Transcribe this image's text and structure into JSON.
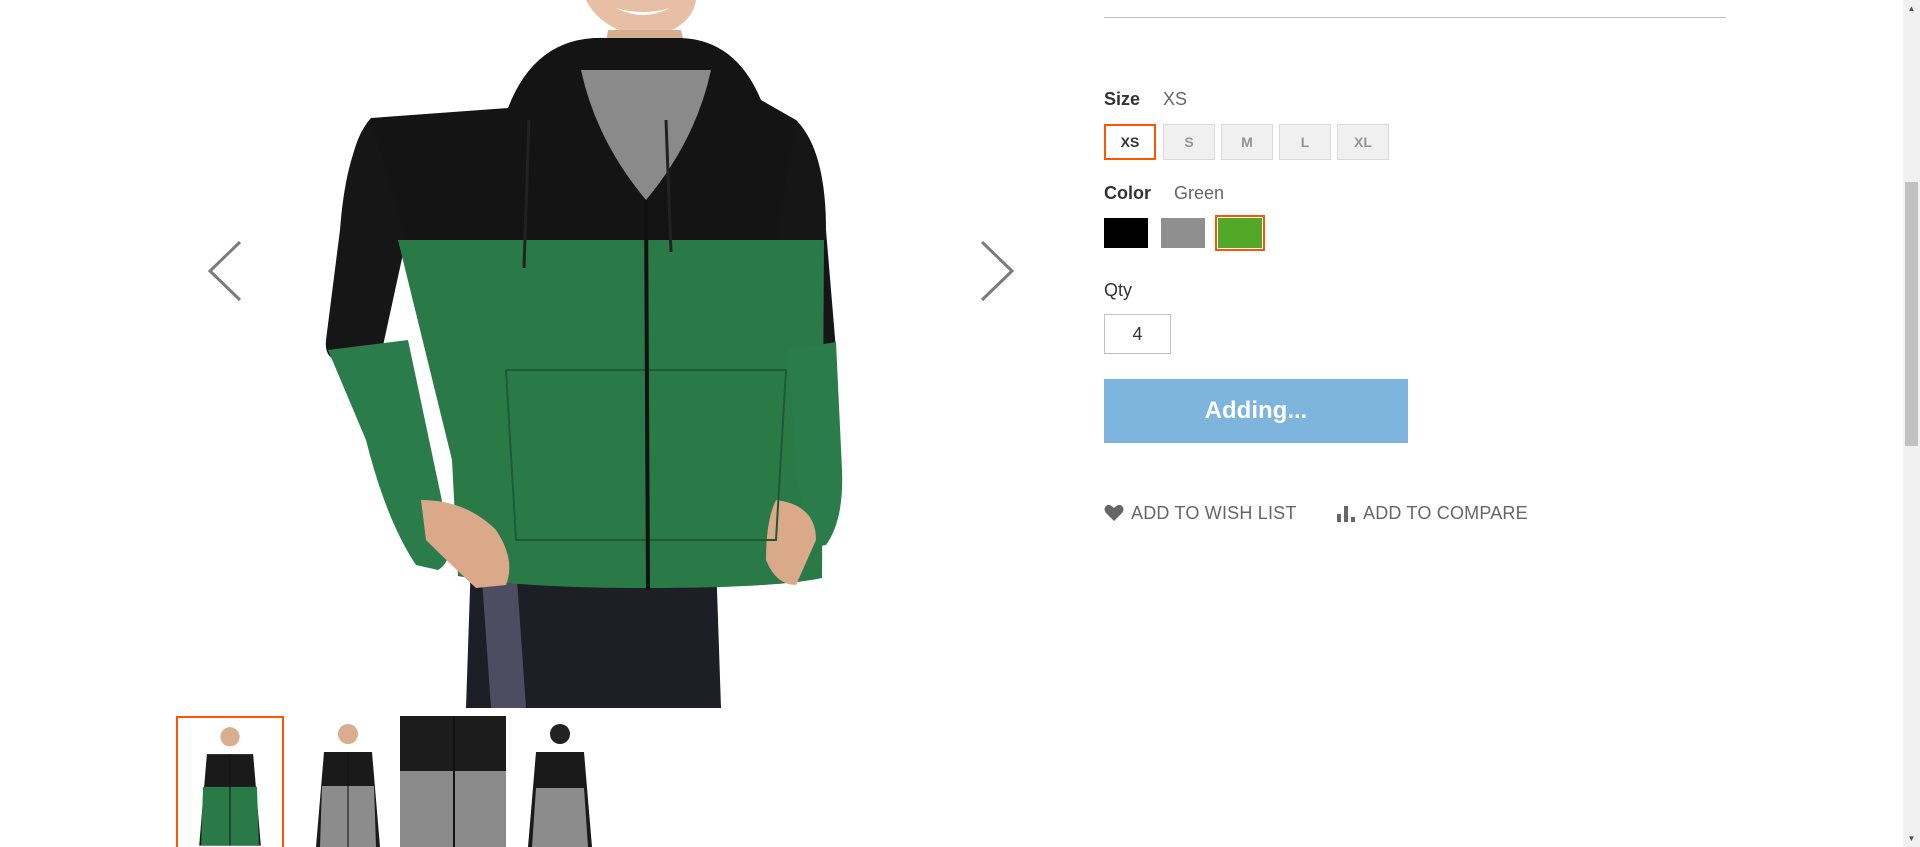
{
  "product": {
    "size": {
      "label": "Size",
      "selected": "XS",
      "options": [
        "XS",
        "S",
        "M",
        "L",
        "XL"
      ]
    },
    "color": {
      "label": "Color",
      "selected": "Green",
      "options": [
        {
          "name": "Black",
          "hex": "#000000"
        },
        {
          "name": "Gray",
          "hex": "#8f8f8f"
        },
        {
          "name": "Green",
          "hex": "#53a828"
        }
      ]
    },
    "qty": {
      "label": "Qty",
      "value": "4"
    },
    "add_button_label": "Adding...",
    "wishlist_label": "Add to Wish List",
    "compare_label": "Add to Compare"
  },
  "gallery": {
    "prev_icon": "chevron-left-icon",
    "next_icon": "chevron-right-icon",
    "active_thumb": 0,
    "thumbs": [
      "front-green",
      "front-gray",
      "detail-gray",
      "back-gray"
    ]
  },
  "colors": {
    "accent": "#ff5501",
    "button_disabled": "#7db5dd",
    "link": "#666666"
  }
}
